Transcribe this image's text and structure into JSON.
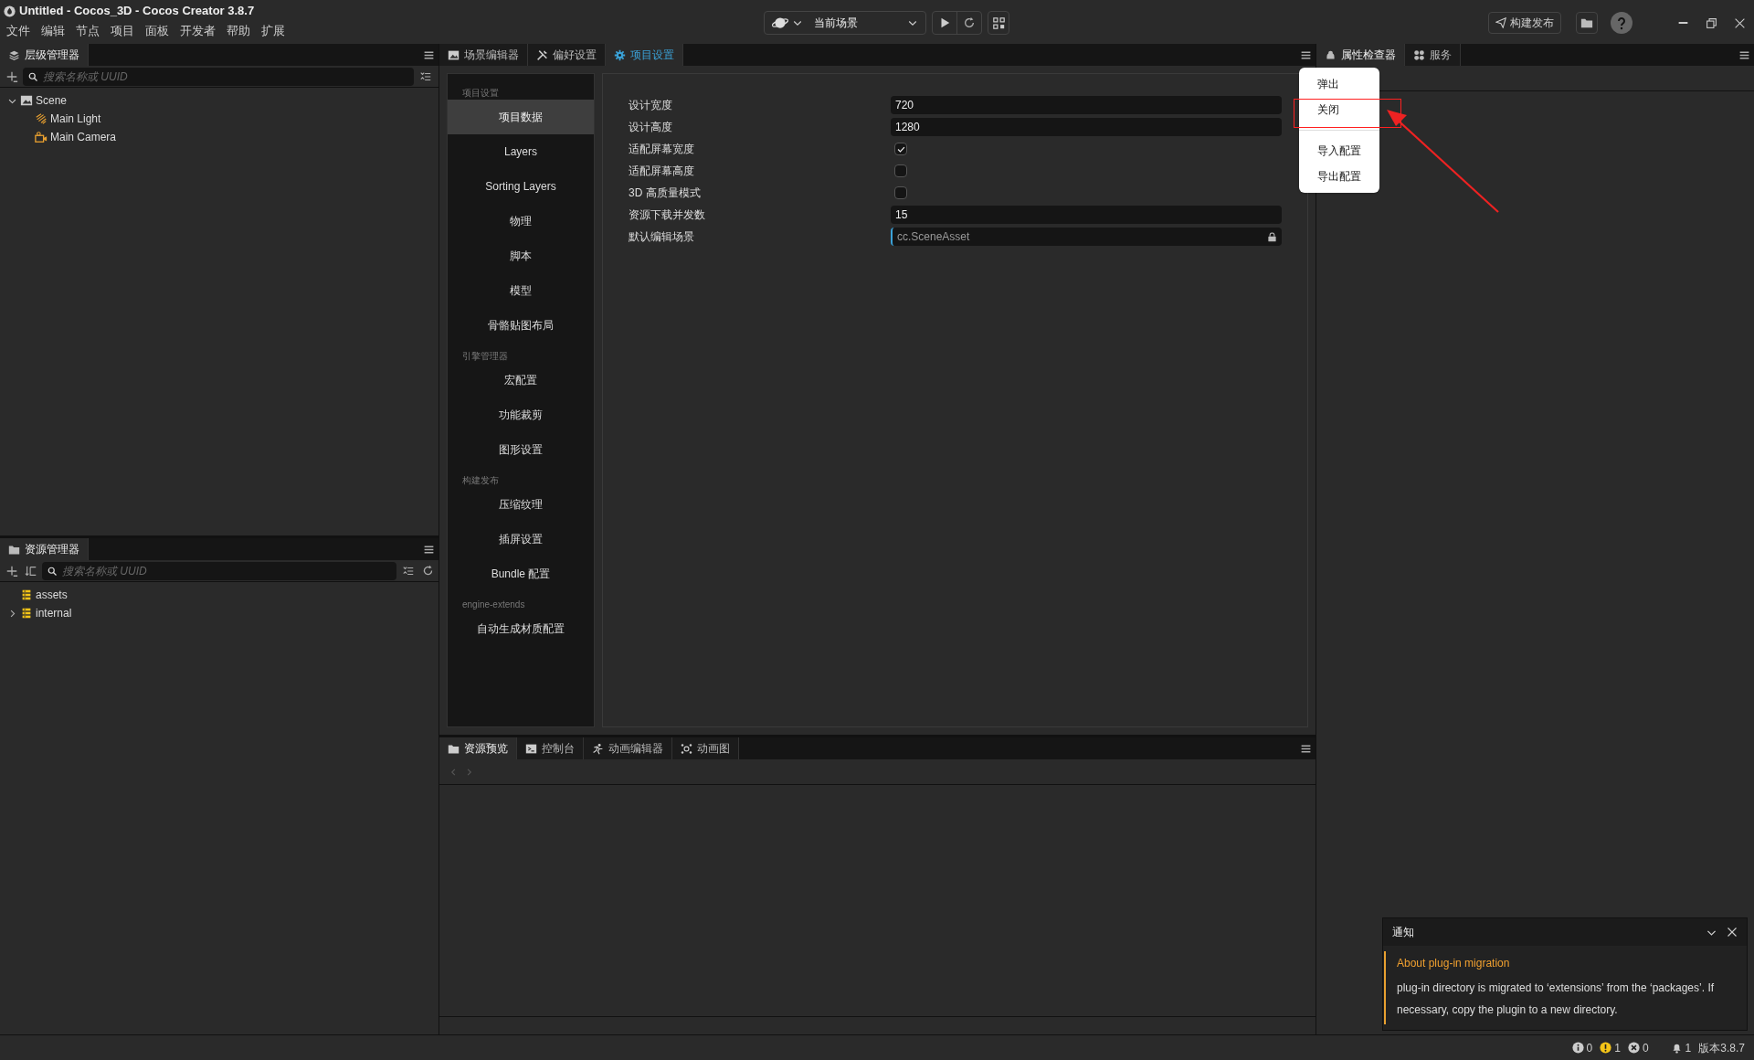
{
  "window": {
    "title": "Untitled - Cocos_3D - Cocos Creator 3.8.7"
  },
  "menu_bar": [
    "文件",
    "编辑",
    "节点",
    "项目",
    "面板",
    "开发者",
    "帮助",
    "扩展"
  ],
  "toolbar": {
    "scene_select": "当前场景",
    "build_button": "构建发布"
  },
  "hierarchy": {
    "tab": "层级管理器",
    "search_placeholder": "搜索名称或 UUID",
    "tree": [
      {
        "label": "Scene",
        "kind": "scene",
        "expanded": true,
        "children": [
          {
            "label": "Main Light",
            "kind": "light"
          },
          {
            "label": "Main Camera",
            "kind": "camera"
          }
        ]
      }
    ]
  },
  "assets": {
    "tab": "资源管理器",
    "search_placeholder": "搜索名称或 UUID",
    "tree": [
      {
        "label": "assets",
        "kind": "db"
      },
      {
        "label": "internal",
        "kind": "db",
        "expanded": false
      }
    ]
  },
  "center_tabs": [
    {
      "label": "场景编辑器",
      "kind": "scene",
      "selected": false
    },
    {
      "label": "偏好设置",
      "kind": "prefs",
      "selected": false
    },
    {
      "label": "项目设置",
      "kind": "settings",
      "selected": true
    }
  ],
  "settings_nav": [
    {
      "heading": "项目设置",
      "items": [
        {
          "label": "项目数据",
          "selected": true
        },
        {
          "label": "Layers",
          "selected": false
        },
        {
          "label": "Sorting Layers",
          "selected": false
        },
        {
          "label": "物理",
          "selected": false
        },
        {
          "label": "脚本",
          "selected": false
        },
        {
          "label": "模型",
          "selected": false
        },
        {
          "label": "骨骼贴图布局",
          "selected": false
        }
      ]
    },
    {
      "heading": "引擎管理器",
      "items": [
        {
          "label": "宏配置",
          "selected": false
        },
        {
          "label": "功能裁剪",
          "selected": false
        },
        {
          "label": "图形设置",
          "selected": false
        }
      ]
    },
    {
      "heading": "构建发布",
      "items": [
        {
          "label": "压缩纹理",
          "selected": false
        },
        {
          "label": "插屏设置",
          "selected": false
        },
        {
          "label": "Bundle 配置",
          "selected": false
        }
      ]
    },
    {
      "heading": "engine-extends",
      "items": [
        {
          "label": "自动生成材质配置",
          "selected": false
        }
      ]
    }
  ],
  "fields": [
    {
      "label": "设计宽度",
      "kind": "text",
      "value": "720"
    },
    {
      "label": "设计高度",
      "kind": "text",
      "value": "1280"
    },
    {
      "label": "适配屏幕宽度",
      "kind": "checkbox",
      "checked": true
    },
    {
      "label": "适配屏幕高度",
      "kind": "checkbox",
      "checked": false
    },
    {
      "label": "3D 高质量模式",
      "kind": "checkbox",
      "checked": false
    },
    {
      "label": "资源下载并发数",
      "kind": "text",
      "value": "15"
    },
    {
      "label": "默认编辑场景",
      "kind": "asset",
      "value": "cc.SceneAsset"
    }
  ],
  "bottom_tabs": [
    {
      "label": "资源预览",
      "kind": "preview",
      "selected": true
    },
    {
      "label": "控制台",
      "kind": "console",
      "selected": false
    },
    {
      "label": "动画编辑器",
      "kind": "animation",
      "selected": false
    },
    {
      "label": "动画图",
      "kind": "graph",
      "selected": false
    }
  ],
  "right_tabs": [
    {
      "label": "属性检查器",
      "kind": "inspector",
      "selected": true
    },
    {
      "label": "服务",
      "kind": "services",
      "selected": false
    }
  ],
  "context_menu": [
    [
      "弹出",
      "关闭"
    ],
    [
      "导入配置",
      "导出配置"
    ]
  ],
  "notification": {
    "title": "通知",
    "heading": "About plug-in migration",
    "body": "plug-in directory is migrated to ‘extensions’ from the ‘packages’. If necessary, copy the plugin to a new directory."
  },
  "status_bar": {
    "info": "0",
    "warnings": "1",
    "errors": "0",
    "notices": "1",
    "version": "版本3.8.7"
  }
}
